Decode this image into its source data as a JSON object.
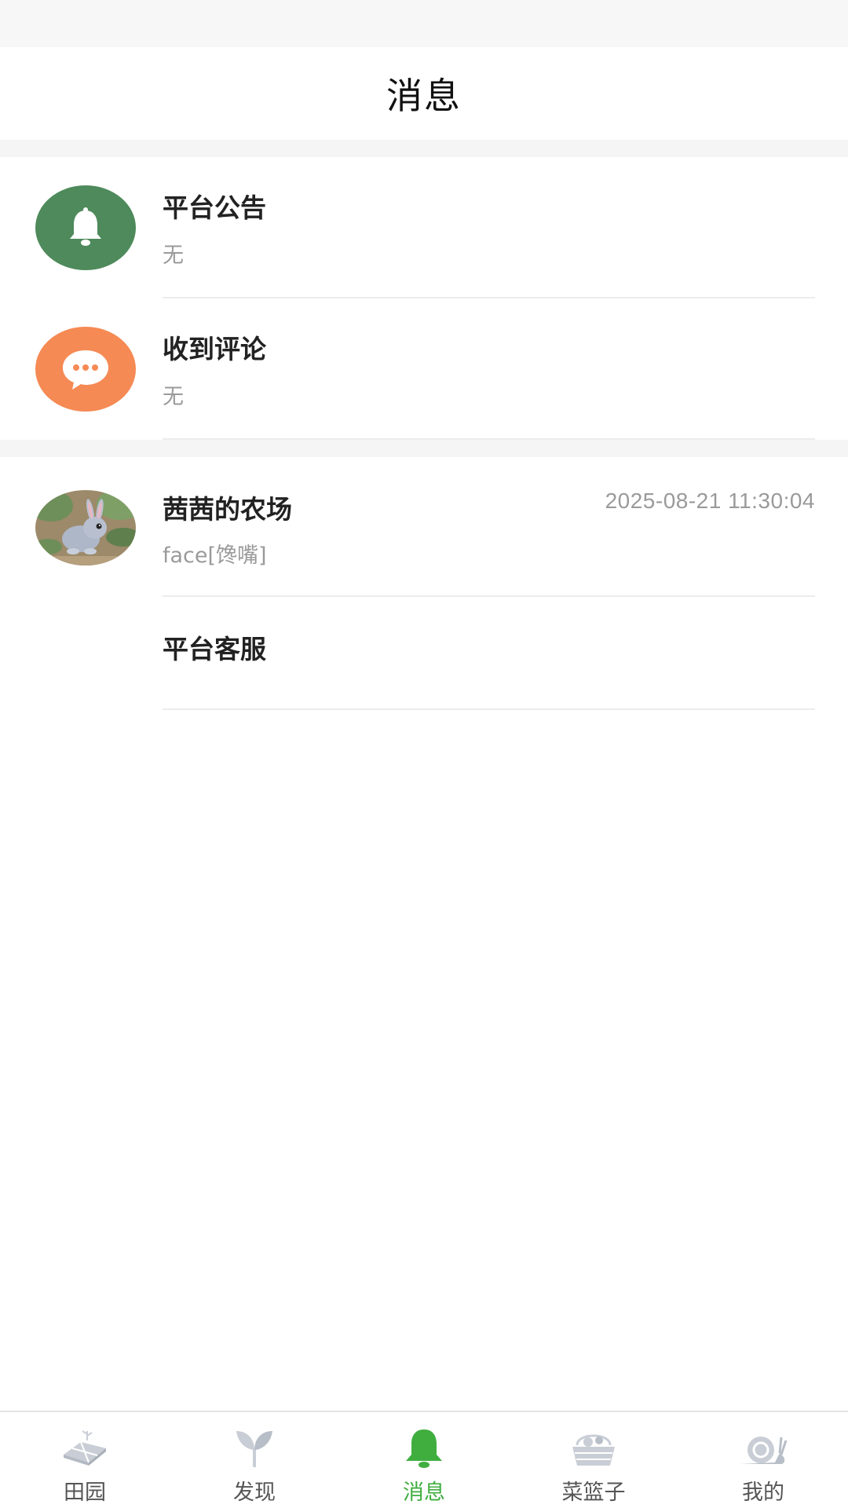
{
  "header": {
    "title": "消息"
  },
  "system_items": [
    {
      "name": "平台公告",
      "sub": "无",
      "icon": "bell-icon",
      "color": "#4e8a5b"
    },
    {
      "name": "收到评论",
      "sub": "无",
      "icon": "chat-bubble-icon",
      "color": "#f58a54"
    }
  ],
  "chats": [
    {
      "name": "茜茜的农场",
      "time": "2025-08-21 11:30:04",
      "last_message": "face[馋嘴]",
      "icon": "rabbit-avatar"
    },
    {
      "name": "平台客服",
      "time": "",
      "last_message": ""
    }
  ],
  "tabs": [
    {
      "label": "田园",
      "icon": "field-icon",
      "active": false
    },
    {
      "label": "发现",
      "icon": "sprout-icon",
      "active": false
    },
    {
      "label": "消息",
      "icon": "bell-icon",
      "active": true
    },
    {
      "label": "菜篮子",
      "icon": "basket-icon",
      "active": false
    },
    {
      "label": "我的",
      "icon": "snail-icon",
      "active": false
    }
  ],
  "colors": {
    "active_tab": "#3fae3f",
    "inactive_icon": "#c9ced6"
  }
}
